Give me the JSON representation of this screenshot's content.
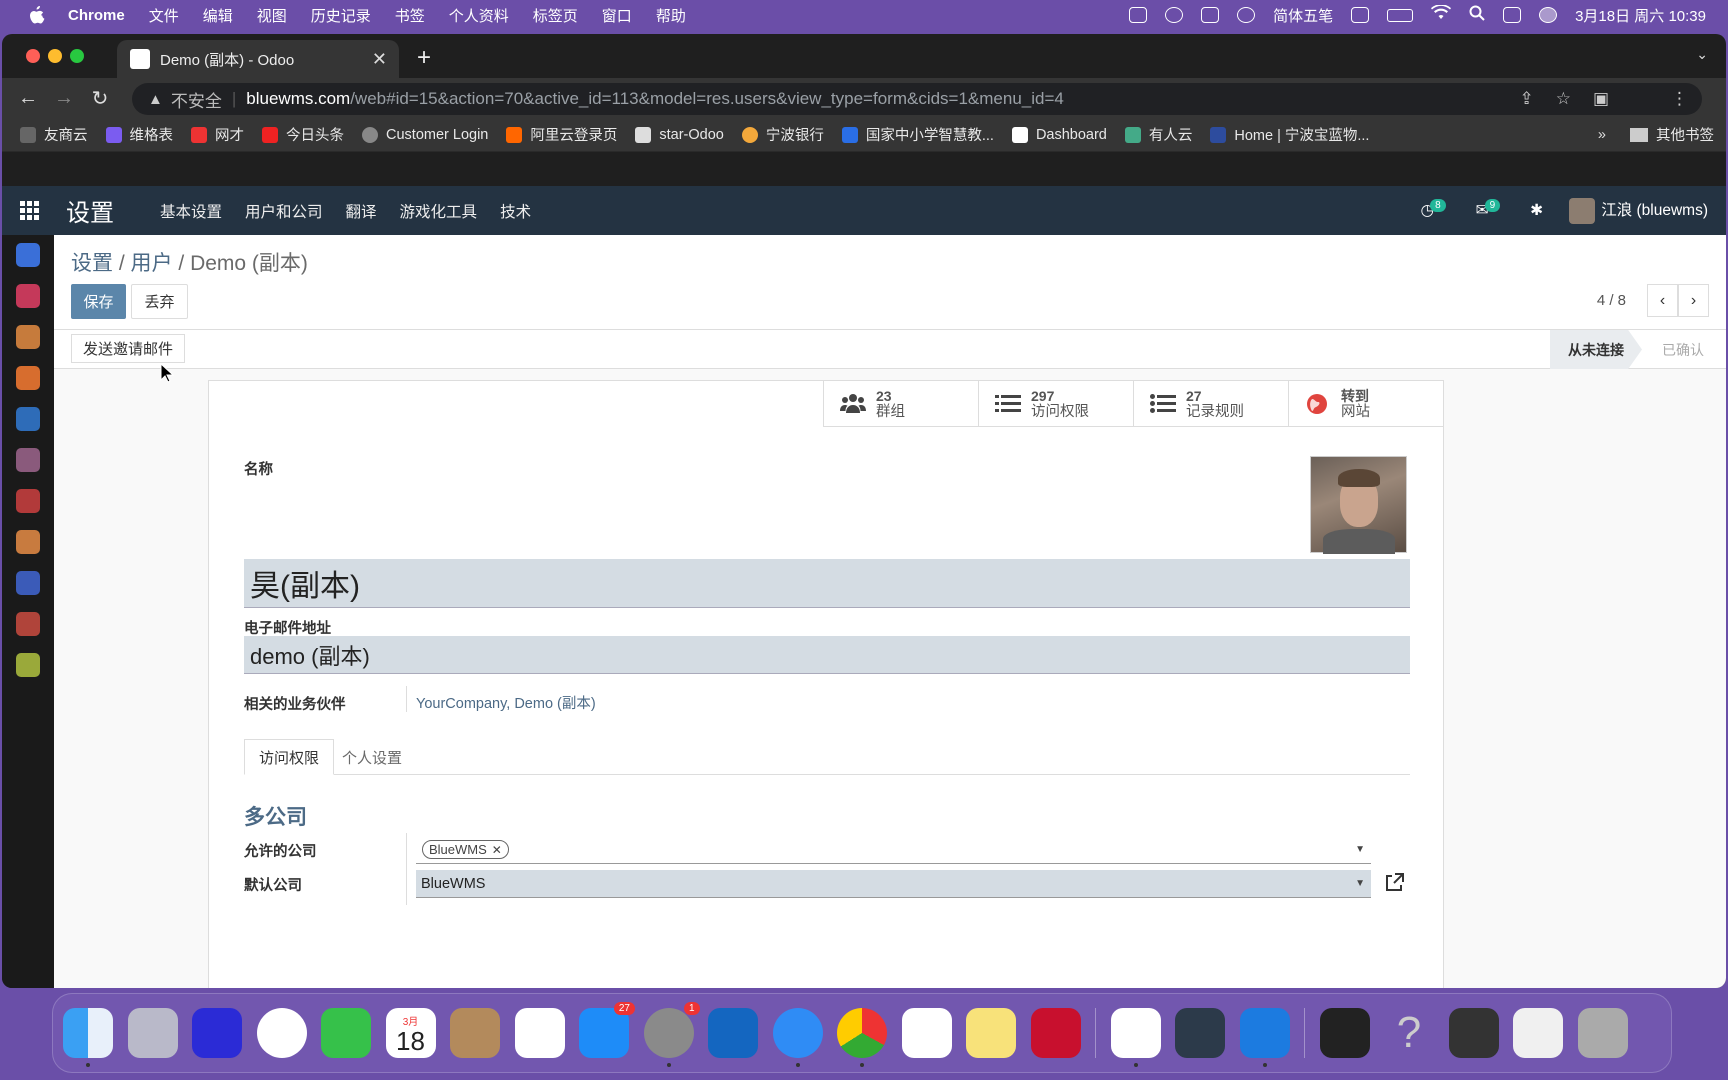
{
  "menubar": {
    "app_name": "Chrome",
    "items": [
      "文件",
      "编辑",
      "视图",
      "历史记录",
      "书签",
      "个人资料",
      "标签页",
      "窗口",
      "帮助"
    ],
    "input_method": "简体五笔",
    "datetime": "3月18日 周六  10:39"
  },
  "browser": {
    "tab_title": "Demo (副本) - Odoo",
    "security_label": "不安全",
    "url_host": "bluewms.com",
    "url_path": "/web#id=15&action=70&active_id=113&model=res.users&view_type=form&cids=1&menu_id=4",
    "bookmarks": [
      "友商云",
      "维格表",
      "网才",
      "今日头条",
      "Customer Login",
      "阿里云登录页",
      "star-Odoo",
      "宁波银行",
      "国家中小学智慧教...",
      "Dashboard",
      "有人云",
      "Home | 宁波宝蓝物..."
    ],
    "more_bookmarks": "»",
    "other_bookmarks": "其他书签"
  },
  "odoo_nav": {
    "brand": "设置",
    "menus": [
      "基本设置",
      "用户和公司",
      "翻译",
      "游戏化工具",
      "技术"
    ],
    "activity_count": "8",
    "message_count": "9",
    "user_name": "江浪 (bluewms)"
  },
  "control_panel": {
    "crumb_settings": "设置",
    "crumb_users": "用户",
    "crumb_current": "Demo (副本)",
    "separator": "/",
    "save_label": "保存",
    "discard_label": "丢弃",
    "pager_value": "4 / 8"
  },
  "status_bar": {
    "invite_label": "发送邀请邮件",
    "state_never": "从未连接",
    "state_confirmed": "已确认"
  },
  "smart_buttons": [
    {
      "value": "23",
      "label": "群组"
    },
    {
      "value": "297",
      "label": "访问权限"
    },
    {
      "value": "27",
      "label": "记录规则"
    },
    {
      "value": "转到",
      "label": "网站"
    }
  ],
  "form": {
    "name_label": "名称",
    "name_value": "昊(副本)",
    "email_label": "电子邮件地址",
    "email_value": "demo (副本)",
    "partner_label": "相关的业务伙伴",
    "partner_value": "YourCompany, Demo (副本)",
    "tab_access": "访问权限",
    "tab_preferences": "个人设置",
    "group_title": "多公司",
    "allowed_label": "允许的公司",
    "allowed_tag": "BlueWMS",
    "default_label": "默认公司",
    "default_value": "BlueWMS"
  },
  "dock": {
    "calendar_month": "3月",
    "calendar_day": "18",
    "appstore_badge": "27",
    "settings_badge": "1"
  },
  "colors": {
    "odoo_nav_bg": "#243342",
    "primary_button": "#5b86aa",
    "link": "#4c6a86",
    "input_bg": "#d4dce3"
  }
}
